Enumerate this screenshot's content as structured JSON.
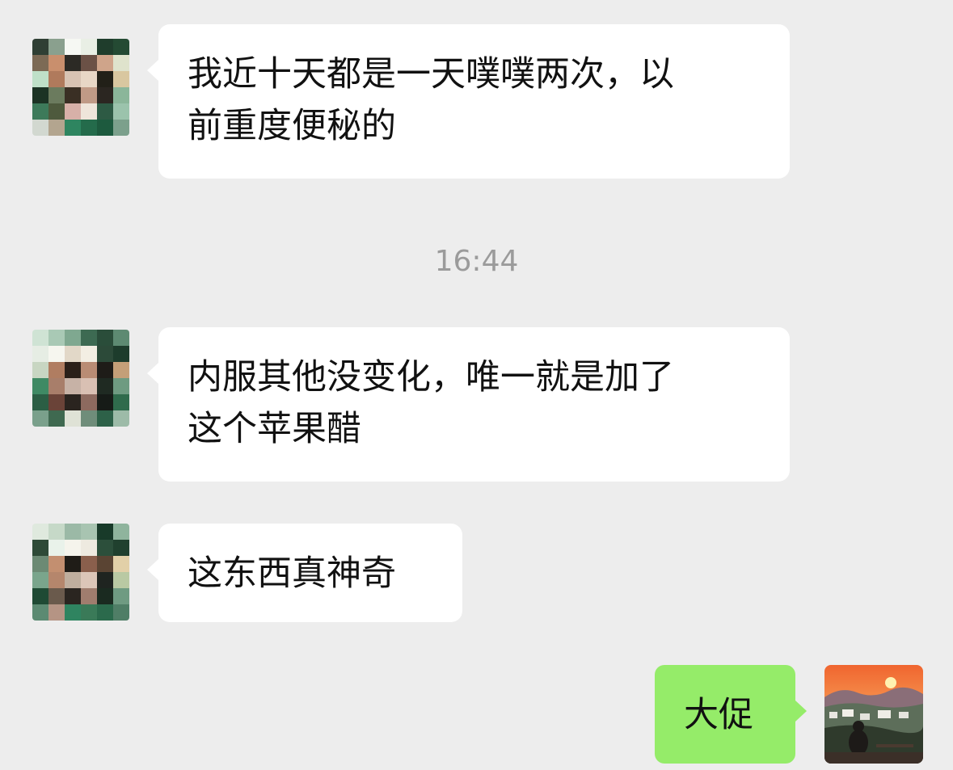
{
  "messages": [
    {
      "side": "incoming",
      "lines": [
        "我近十天都是一天噗噗两次，以",
        "前重度便秘的"
      ]
    },
    {
      "side": "incoming",
      "lines": [
        "内服其他没变化，唯一就是加了",
        "这个苹果醋"
      ]
    },
    {
      "side": "incoming",
      "lines": [
        "这东西真神奇"
      ]
    },
    {
      "side": "outgoing",
      "lines": [
        "大促"
      ]
    }
  ],
  "timestamp": "16:44",
  "colors": {
    "background": "#ededed",
    "incoming_bubble": "#ffffff",
    "outgoing_bubble": "#95ec69",
    "timestamp_text": "#9b9b9b"
  }
}
